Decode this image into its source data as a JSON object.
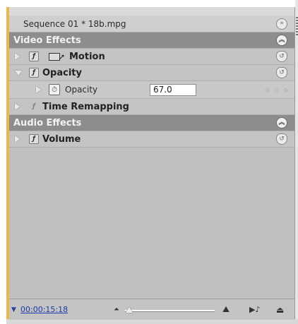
{
  "panel": {
    "sequence_title": "Sequence 01 * 18b.mpg",
    "sequence_toggle_icon": "double-chevron-right-icon"
  },
  "video_effects": {
    "title": "Video Effects",
    "collapse_icon": "double-chevron-up-icon",
    "effects": [
      {
        "name": "Motion",
        "expanded": false
      },
      {
        "name": "Opacity",
        "expanded": true,
        "properties": [
          {
            "name": "Opacity",
            "value": "67.0"
          }
        ]
      },
      {
        "name": "Time Remapping",
        "expanded": false
      }
    ]
  },
  "audio_effects": {
    "title": "Audio Effects",
    "collapse_icon": "double-chevron-up-icon",
    "effects": [
      {
        "name": "Volume",
        "expanded": false
      }
    ]
  },
  "bottom_bar": {
    "timecode": "00:00:15:18",
    "zoom": 0.05
  },
  "colors": {
    "accent": "#e8b84a",
    "section_header": "#8d8d8d",
    "panel_bg": "#c0c0c0",
    "timecode": "#1a3aa8"
  }
}
